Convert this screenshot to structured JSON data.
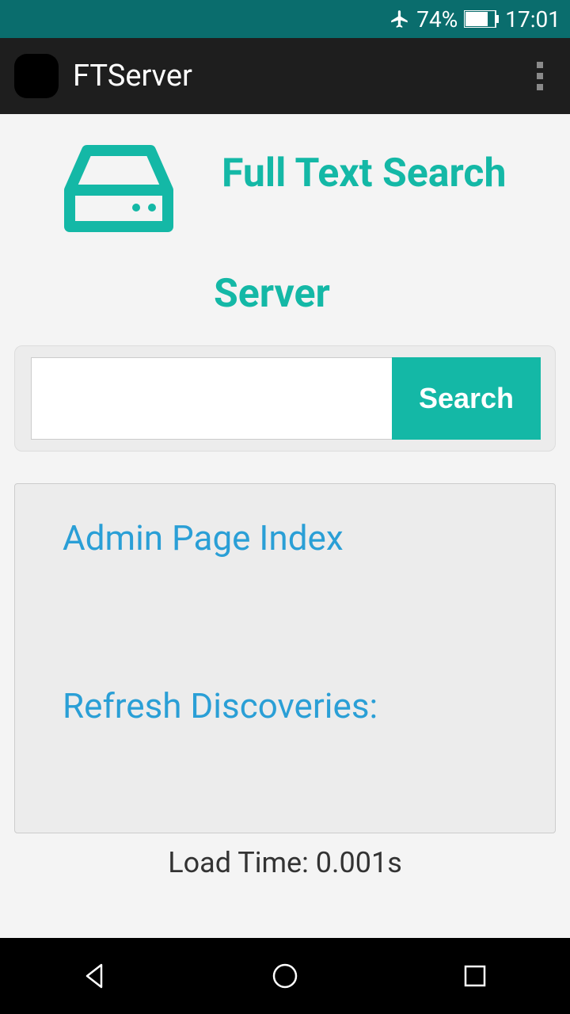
{
  "status_bar": {
    "battery_percent": "74%",
    "time": "17:01"
  },
  "action_bar": {
    "title": "FTServer"
  },
  "page": {
    "title_line1": "Full Text Search",
    "title_line2": "Server"
  },
  "search": {
    "button_label": "Search",
    "input_value": ""
  },
  "links": {
    "admin": "Admin Page Index",
    "refresh": "Refresh Discoveries:"
  },
  "footer": {
    "load_time": "Load Time: 0.001s"
  }
}
